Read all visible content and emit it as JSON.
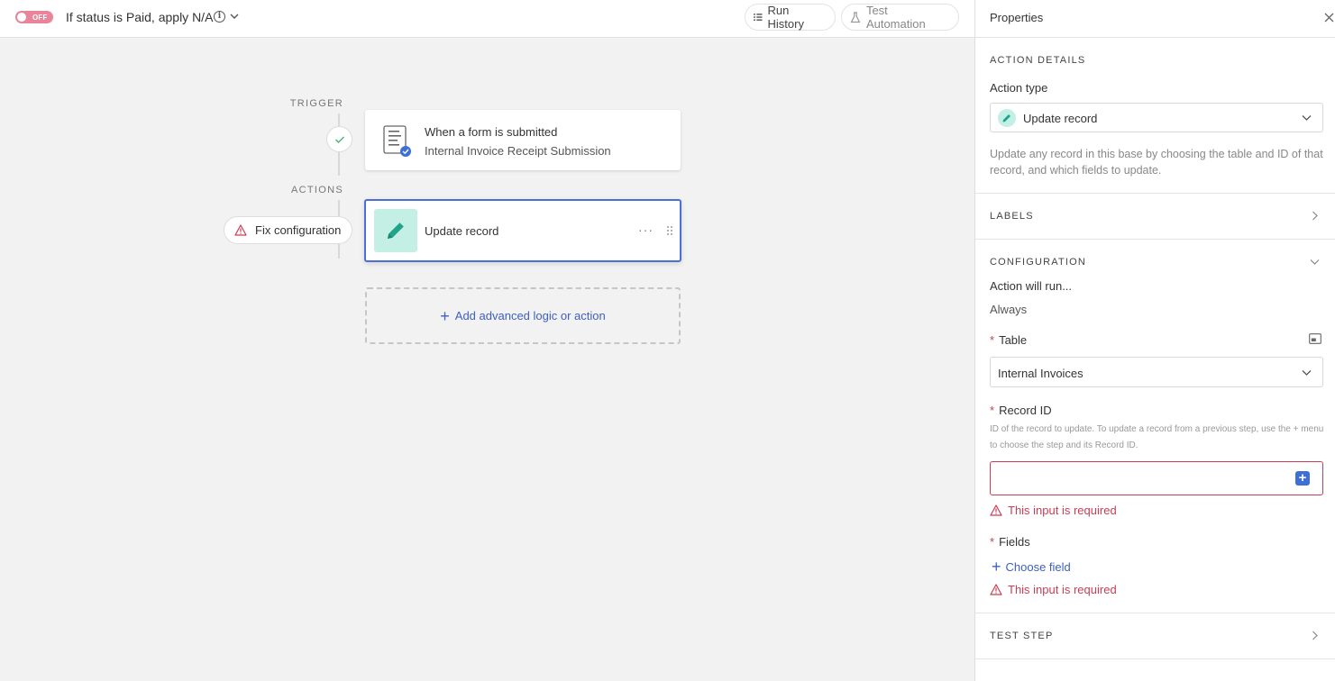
{
  "topbar": {
    "toggle_label": "OFF",
    "automation_title": "If status is Paid, apply N/A",
    "run_history_label": "Run History",
    "test_automation_label": "Test Automation"
  },
  "canvas": {
    "trigger_label": "TRIGGER",
    "actions_label": "ACTIONS",
    "trigger_card": {
      "title": "When a form is submitted",
      "subtitle": "Internal Invoice Receipt Submission"
    },
    "action_card": {
      "title": "Update record"
    },
    "fix_configuration_label": "Fix configuration",
    "add_action_label": "Add advanced logic or action"
  },
  "panel": {
    "title": "Properties",
    "action_details_heading": "ACTION DETAILS",
    "action_type_label": "Action type",
    "action_type_value": "Update record",
    "action_type_description": "Update any record in this base by choosing the table and ID of that record, and which fields to update.",
    "labels_heading": "LABELS",
    "configuration_heading": "CONFIGURATION",
    "action_will_run_label": "Action will run...",
    "action_will_run_value": "Always",
    "table_label": "Table",
    "table_value": "Internal Invoices",
    "record_id_label": "Record ID",
    "record_id_description": "ID of the record to update. To update a record from a previous step, use the + menu to choose the step and its Record ID.",
    "record_id_value": "",
    "record_id_error": "This input is required",
    "fields_label": "Fields",
    "choose_field_label": "Choose field",
    "fields_error": "This input is required",
    "test_step_heading": "TEST STEP",
    "required_marker": "*"
  },
  "colors": {
    "accent_blue": "#4a6fd6",
    "link_blue": "#3e5fc2",
    "error_red": "#c93d55",
    "toggle_off_pink": "#e8859b",
    "action_teal_bg": "#c3efe4",
    "action_teal_icon": "#20a38a"
  }
}
